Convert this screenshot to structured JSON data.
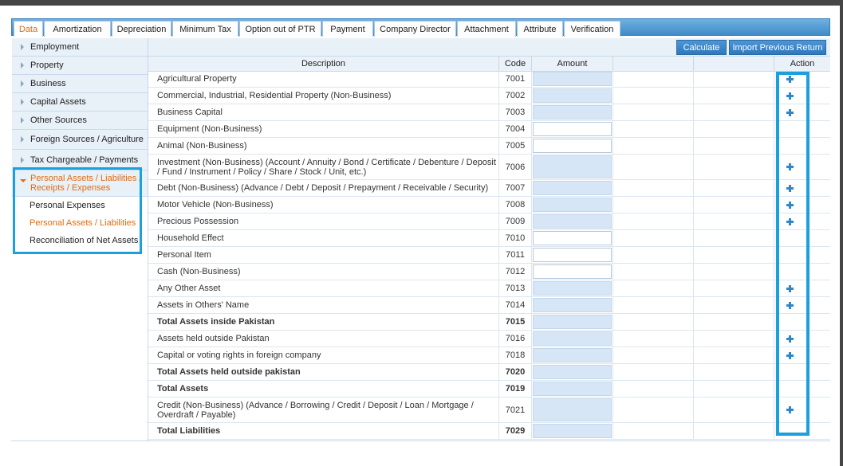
{
  "tabs": [
    {
      "label": "Data",
      "active": true
    },
    {
      "label": "Amortization"
    },
    {
      "label": "Depreciation"
    },
    {
      "label": "Minimum Tax"
    },
    {
      "label": "Option out of PTR"
    },
    {
      "label": "Payment"
    },
    {
      "label": "Company Director"
    },
    {
      "label": "Attachment"
    },
    {
      "label": "Attribute"
    },
    {
      "label": "Verification"
    }
  ],
  "sidebar": {
    "items": [
      {
        "label": "Employment"
      },
      {
        "label": "Property"
      },
      {
        "label": "Business"
      },
      {
        "label": "Capital Assets"
      },
      {
        "label": "Other Sources"
      },
      {
        "label": "Foreign Sources / Agriculture"
      },
      {
        "label": "Tax Chargeable / Payments"
      },
      {
        "label": "Personal Assets / Liabilities / Receipts / Expenses",
        "expanded": true
      }
    ],
    "sub_items": [
      {
        "label": "Personal Expenses"
      },
      {
        "label": "Personal Assets / Liabilities",
        "active": true
      },
      {
        "label": "Reconciliation of Net Assets"
      }
    ]
  },
  "toolbar": {
    "calculate_label": "Calculate",
    "import_label": "Import Previous Return"
  },
  "table": {
    "headers": {
      "description": "Description",
      "code": "Code",
      "amount": "Amount",
      "action": "Action"
    },
    "rows": [
      {
        "description": "Agricultural Property",
        "code": "7001",
        "amount": "",
        "editable": false,
        "action": true,
        "bold": false
      },
      {
        "description": "Commercial, Industrial, Residential Property (Non-Business)",
        "code": "7002",
        "amount": "",
        "editable": false,
        "action": true,
        "bold": false
      },
      {
        "description": "Business Capital",
        "code": "7003",
        "amount": "",
        "editable": false,
        "action": true,
        "bold": false
      },
      {
        "description": "Equipment (Non-Business)",
        "code": "7004",
        "amount": "",
        "editable": true,
        "action": false,
        "bold": false
      },
      {
        "description": "Animal (Non-Business)",
        "code": "7005",
        "amount": "",
        "editable": true,
        "action": false,
        "bold": false
      },
      {
        "description": "Investment (Non-Business) (Account / Annuity / Bond / Certificate / Debenture / Deposit / Fund / Instrument / Policy / Share / Stock / Unit, etc.)",
        "code": "7006",
        "amount": "",
        "editable": false,
        "action": true,
        "bold": false
      },
      {
        "description": "Debt (Non-Business) (Advance / Debt / Deposit / Prepayment / Receivable / Security)",
        "code": "7007",
        "amount": "",
        "editable": false,
        "action": true,
        "bold": false
      },
      {
        "description": "Motor Vehicle (Non-Business)",
        "code": "7008",
        "amount": "",
        "editable": false,
        "action": true,
        "bold": false
      },
      {
        "description": "Precious Possession",
        "code": "7009",
        "amount": "",
        "editable": false,
        "action": true,
        "bold": false
      },
      {
        "description": "Household Effect",
        "code": "7010",
        "amount": "",
        "editable": true,
        "action": false,
        "bold": false
      },
      {
        "description": "Personal Item",
        "code": "7011",
        "amount": "",
        "editable": true,
        "action": false,
        "bold": false
      },
      {
        "description": "Cash (Non-Business)",
        "code": "7012",
        "amount": "",
        "editable": true,
        "action": false,
        "bold": false
      },
      {
        "description": "Any Other Asset",
        "code": "7013",
        "amount": "",
        "editable": false,
        "action": true,
        "bold": false
      },
      {
        "description": "Assets in Others' Name",
        "code": "7014",
        "amount": "",
        "editable": false,
        "action": true,
        "bold": false
      },
      {
        "description": "Total Assets inside Pakistan",
        "code": "7015",
        "amount": "",
        "editable": false,
        "action": false,
        "bold": true
      },
      {
        "description": "Assets held outside Pakistan",
        "code": "7016",
        "amount": "",
        "editable": false,
        "action": true,
        "bold": false
      },
      {
        "description": "Capital or voting rights in foreign company",
        "code": "7018",
        "amount": "",
        "editable": false,
        "action": true,
        "bold": false
      },
      {
        "description": "Total Assets held outside pakistan",
        "code": "7020",
        "amount": "",
        "editable": false,
        "action": false,
        "bold": true
      },
      {
        "description": "Total Assets",
        "code": "7019",
        "amount": "",
        "editable": false,
        "action": false,
        "bold": true
      },
      {
        "description": "Credit (Non-Business) (Advance / Borrowing / Credit / Deposit / Loan / Mortgage / Overdraft / Payable)",
        "code": "7021",
        "amount": "",
        "editable": false,
        "action": true,
        "bold": false
      },
      {
        "description": "Total Liabilities",
        "code": "7029",
        "amount": "",
        "editable": false,
        "action": false,
        "bold": true
      }
    ]
  },
  "colors": {
    "accent": "#1aa0dc",
    "active_text": "#e26b10",
    "button": "#3a82c4"
  }
}
